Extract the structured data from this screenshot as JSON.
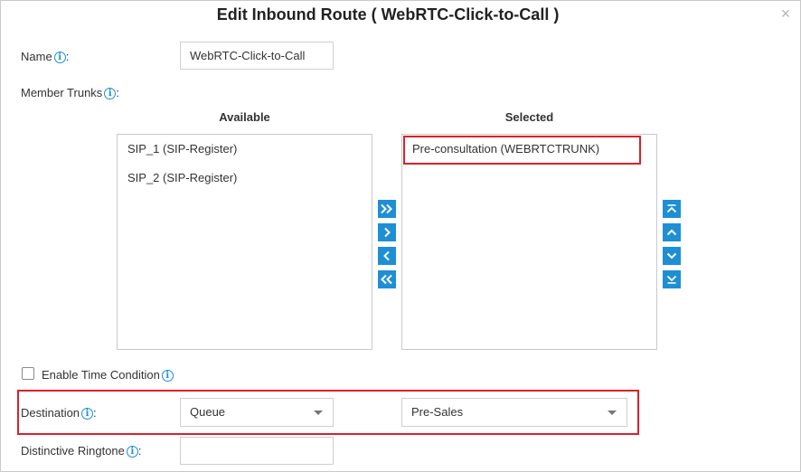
{
  "dialog": {
    "title": "Edit Inbound Route ( WebRTC-Click-to-Call )",
    "close_glyph": "×"
  },
  "name": {
    "label": "Name",
    "suffix": ":",
    "value": "WebRTC-Click-to-Call"
  },
  "member_trunks": {
    "label": "Member Trunks",
    "suffix": ":",
    "available_heading": "Available",
    "selected_heading": "Selected",
    "available_items": [
      "SIP_1 (SIP-Register)",
      "SIP_2 (SIP-Register)"
    ],
    "selected_items": [
      "Pre-consultation (WEBRTCTRUNK)"
    ],
    "transfer_buttons": [
      "move-all-right-icon",
      "move-right-icon",
      "move-left-icon",
      "move-all-left-icon"
    ],
    "order_buttons": [
      "move-top-icon",
      "move-up-icon",
      "move-down-icon",
      "move-bottom-icon"
    ]
  },
  "time_condition": {
    "label": "Enable Time Condition",
    "checked": false
  },
  "destination": {
    "label": "Destination",
    "suffix": ":",
    "type_value": "Queue",
    "target_value": "Pre-Sales"
  },
  "ringtone": {
    "label": "Distinctive Ringtone",
    "suffix": ":",
    "value": ""
  },
  "info_glyph": "i",
  "colors": {
    "accent": "#1e8fd5",
    "highlight": "#d9212c",
    "border": "#c9c9c9"
  }
}
